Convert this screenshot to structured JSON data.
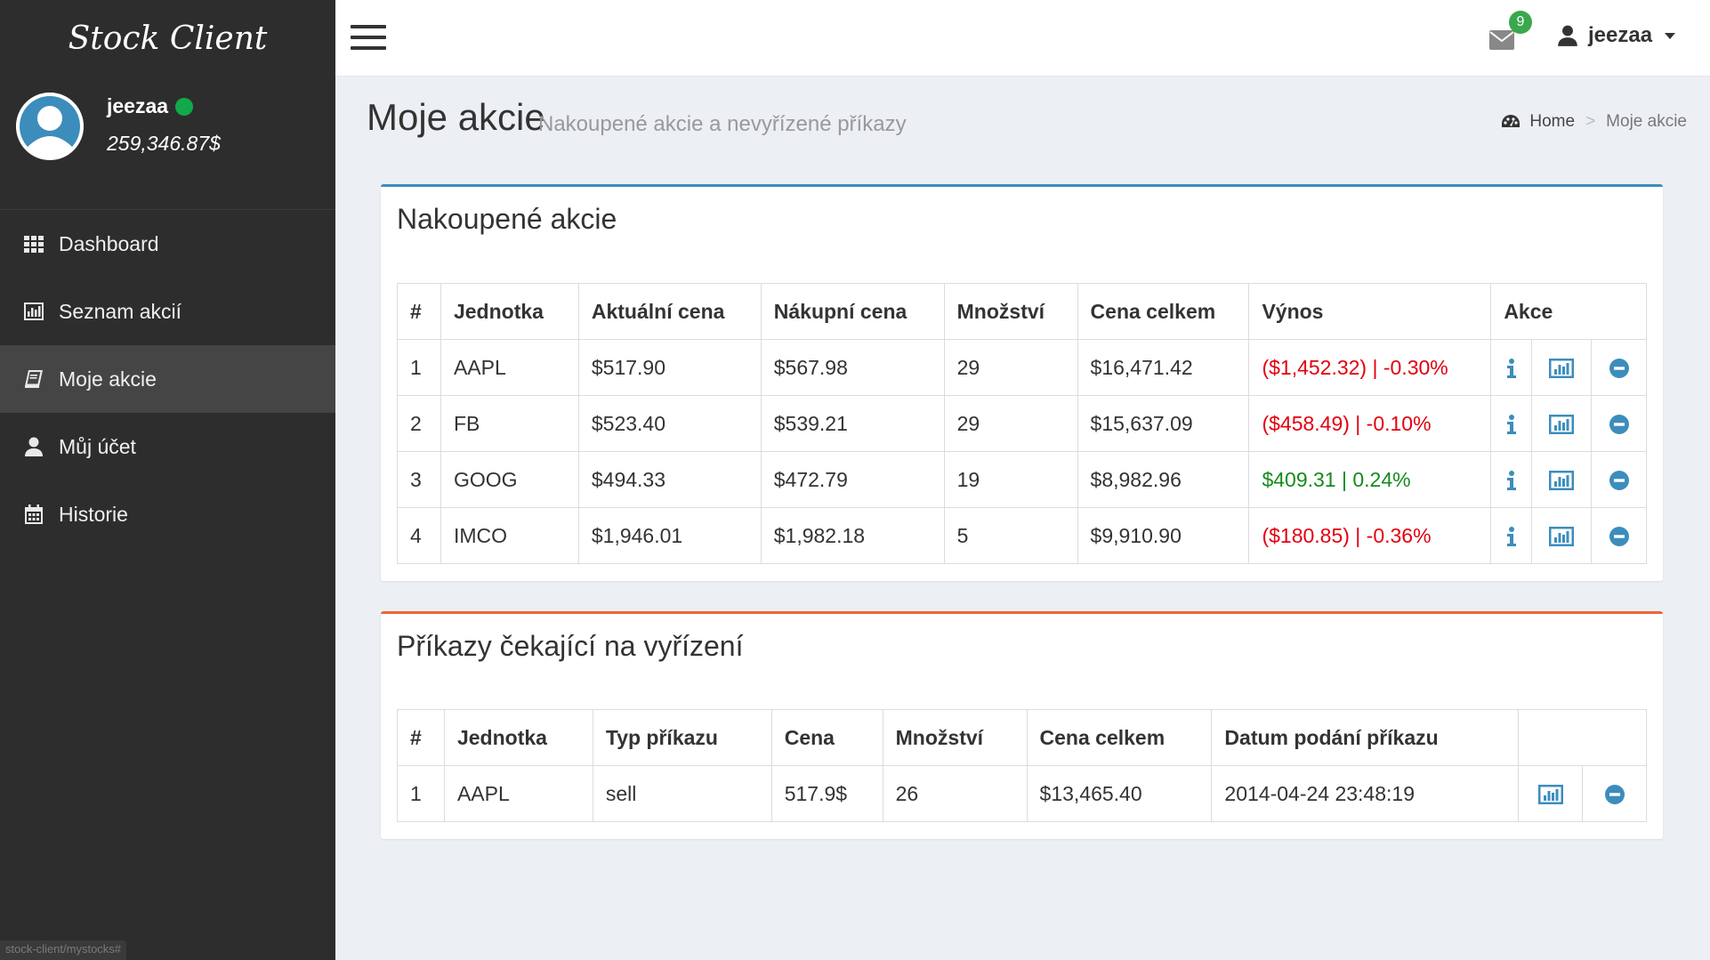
{
  "app": {
    "brand": "Stock Client"
  },
  "user": {
    "name": "jeezaa",
    "balance": "259,346.87$"
  },
  "sidebar": {
    "items": [
      {
        "label": "Dashboard",
        "icon": "grid-icon"
      },
      {
        "label": "Seznam akcií",
        "icon": "bar-chart-icon"
      },
      {
        "label": "Moje akcie",
        "icon": "book-icon",
        "active": true
      },
      {
        "label": "Můj účet",
        "icon": "user-icon"
      },
      {
        "label": "Historie",
        "icon": "calendar-icon"
      }
    ]
  },
  "header": {
    "mail_count": "9",
    "username": "jeezaa"
  },
  "page": {
    "title": "Moje akcie",
    "subtitle": "Nakoupené akcie a nevyřízené příkazy",
    "breadcrumb": {
      "home": "Home",
      "current": "Moje akcie",
      "separator": ">"
    }
  },
  "owned": {
    "title": "Nakoupené akcie",
    "columns": [
      "#",
      "Jednotka",
      "Aktuální cena",
      "Nákupní cena",
      "Množství",
      "Cena celkem",
      "Výnos",
      "Akce"
    ],
    "rows": [
      {
        "n": "1",
        "unit": "AAPL",
        "current": "$517.90",
        "purchase": "$567.98",
        "qty": "29",
        "total": "$16,471.42",
        "yield": "($1,452.32) | -0.30%",
        "positive": false
      },
      {
        "n": "2",
        "unit": "FB",
        "current": "$523.40",
        "purchase": "$539.21",
        "qty": "29",
        "total": "$15,637.09",
        "yield": "($458.49) | -0.10%",
        "positive": false
      },
      {
        "n": "3",
        "unit": "GOOG",
        "current": "$494.33",
        "purchase": "$472.79",
        "qty": "19",
        "total": "$8,982.96",
        "yield": "$409.31 | 0.24%",
        "positive": true
      },
      {
        "n": "4",
        "unit": "IMCO",
        "current": "$1,946.01",
        "purchase": "$1,982.18",
        "qty": "5",
        "total": "$9,910.90",
        "yield": "($180.85) | -0.36%",
        "positive": false
      }
    ]
  },
  "pending": {
    "title": "Příkazy čekající na vyřízení",
    "columns": [
      "#",
      "Jednotka",
      "Typ příkazu",
      "Cena",
      "Množství",
      "Cena celkem",
      "Datum podání příkazu",
      ""
    ],
    "rows": [
      {
        "n": "1",
        "unit": "AAPL",
        "type": "sell",
        "price": "517.9$",
        "qty": "26",
        "total": "$13,465.40",
        "date": "2014-04-24 23:48:19"
      }
    ]
  },
  "statusbar": {
    "url": "stock-client/mystocks#"
  },
  "colors": {
    "sidebar_bg": "#2d2d2d",
    "accent_blue": "#3c8dbc",
    "accent_red": "#f0643a",
    "negative": "#e3000f",
    "positive": "#168a1c",
    "online": "#12a94a",
    "badge": "#3aa84d"
  }
}
